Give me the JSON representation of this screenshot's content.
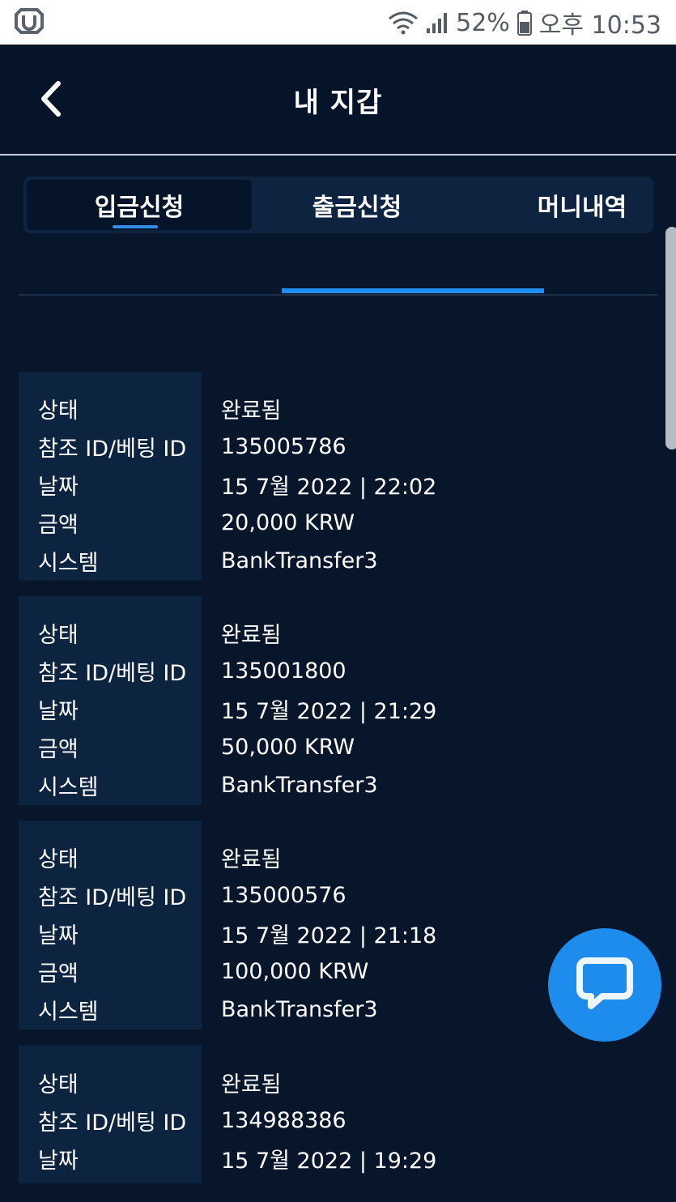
{
  "status_bar": {
    "battery": "52%",
    "time": "오후 10:53",
    "icons": [
      "app-logo-icon",
      "wifi-icon",
      "signal-icon",
      "battery-icon"
    ]
  },
  "header": {
    "title": "내 지갑",
    "back_icon": "chevron-left-icon"
  },
  "tabs": [
    {
      "label": "입금신청",
      "active": true
    },
    {
      "label": "출금신청",
      "active": false
    },
    {
      "label": "머니내역",
      "active": false
    }
  ],
  "labels": {
    "status": "상태",
    "reference": "참조 ID/베팅 ID",
    "date": "날짜",
    "amount": "금액",
    "system": "시스템"
  },
  "transactions": [
    {
      "status": "완료됨",
      "reference": "135005786",
      "date": "15 7월 2022 | 22:02",
      "amount": "20,000 KRW",
      "system": "BankTransfer3"
    },
    {
      "status": "완료됨",
      "reference": "135001800",
      "date": "15 7월 2022 | 21:29",
      "amount": "50,000 KRW",
      "system": "BankTransfer3"
    },
    {
      "status": "완료됨",
      "reference": "135000576",
      "date": "15 7월 2022 | 21:18",
      "amount": "100,000 KRW",
      "system": "BankTransfer3"
    },
    {
      "status": "완료됨",
      "reference": "134988386",
      "date": "15 7월 2022 | 19:29"
    }
  ],
  "chat_button": {
    "icon": "chat-bubble-icon"
  },
  "colors": {
    "background": "#07162a",
    "card_label_bg": "#0c2440",
    "accent": "#1f8ff0",
    "chat_button": "#1d8cec"
  }
}
